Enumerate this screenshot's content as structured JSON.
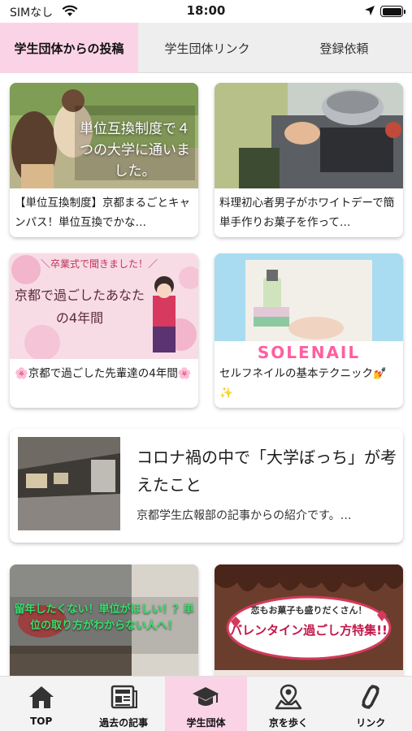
{
  "status_bar": {
    "carrier": "SIMなし",
    "time": "18:00"
  },
  "tabs": [
    {
      "label": "学生団体からの投稿",
      "active": true
    },
    {
      "label": "学生団体リンク",
      "active": false
    },
    {
      "label": "登録依頼",
      "active": false
    }
  ],
  "posts": [
    {
      "title": "【単位互換制度】京都まるごとキャンパス！単位互換でかな…",
      "thumb_caption": "単位互換制度で４つの大学に通いました。"
    },
    {
      "title": "料理初心者男子がホワイトデーで簡単手作りお菓子を作って…"
    },
    {
      "title": "🌸京都で過ごした先輩達の4年間🌸",
      "thumb_banner": "＼卒業式で聞きました！／",
      "thumb_caption": "京都で過ごしたあなたの4年間"
    },
    {
      "title": "セルフネイルの基本テクニック💅✨",
      "thumb_caption": "SOLENAIL"
    },
    {
      "title": "コロナ禍の中で「大学ぼっち」が考えたこと",
      "description": "京都学生広報部の記事からの紹介です。…"
    },
    {
      "title": "",
      "thumb_caption": "留年したくない！単位がほしい！？単位の取り方がわからない人へ！"
    },
    {
      "title": "",
      "thumb_banner": "恋もお菓子も盛りだくさん！",
      "thumb_caption": "バレンタイン過ごし方特集!!"
    }
  ],
  "bottom_nav": [
    {
      "label": "TOP",
      "icon": "home-icon",
      "active": false
    },
    {
      "label": "過去の記事",
      "icon": "news-icon",
      "active": false
    },
    {
      "label": "学生団体",
      "icon": "graduation-cap-icon",
      "active": true
    },
    {
      "label": "京を歩く",
      "icon": "map-pin-icon",
      "active": false
    },
    {
      "label": "リンク",
      "icon": "link-icon",
      "active": false
    }
  ],
  "colors": {
    "accent_pink": "#fbd3e6",
    "tab_bar_bg": "#eeeeee",
    "nav_bg": "#f3f3f3"
  }
}
